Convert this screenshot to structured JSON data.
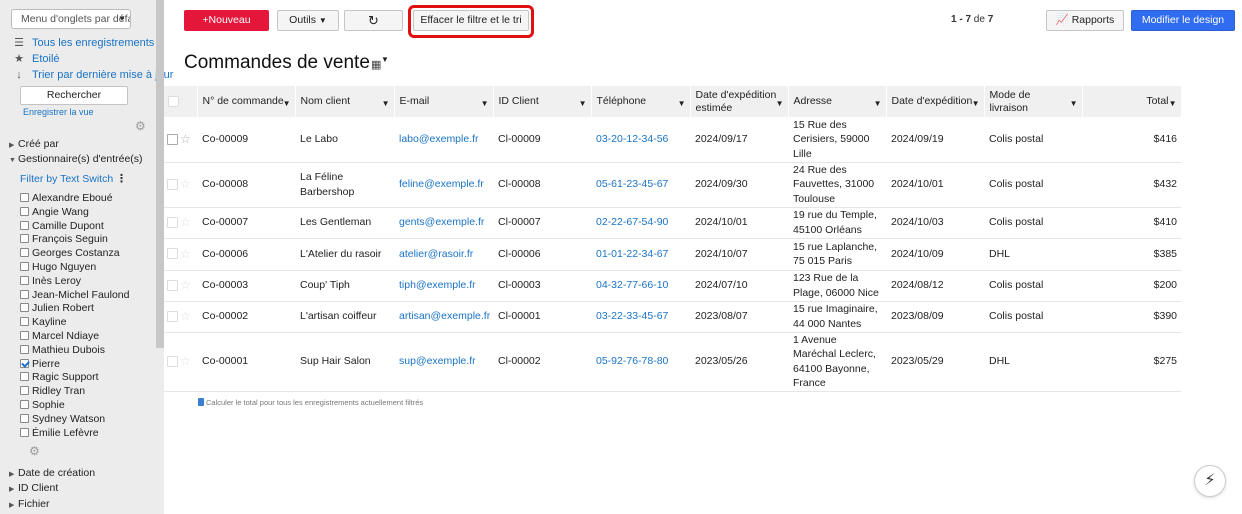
{
  "sidebar": {
    "tab_menu": "Menu d'onglets par défaut",
    "links": [
      {
        "icon": "list-icon",
        "glyph": "☰",
        "label": "Tous les enregistrements"
      },
      {
        "icon": "star-icon",
        "glyph": "★",
        "label": "Etoilé"
      },
      {
        "icon": "sort-icon",
        "glyph": "↓",
        "label": "Trier par dernière mise à jour"
      }
    ],
    "search_button": "Rechercher",
    "save_view": "Enregistrer la vue",
    "sections_top": [
      {
        "label": "Créé par",
        "expanded": false
      },
      {
        "label": "Gestionnaire(s) d'entrée(s)",
        "expanded": true
      }
    ],
    "filter_switch": "Filter by Text Switch",
    "filter_options": [
      {
        "label": "Alexandre Eboué",
        "checked": false
      },
      {
        "label": "Angie Wang",
        "checked": false
      },
      {
        "label": "Camille Dupont",
        "checked": false
      },
      {
        "label": "François Seguin",
        "checked": false
      },
      {
        "label": "Georges Costanza",
        "checked": false
      },
      {
        "label": "Hugo Nguyen",
        "checked": false
      },
      {
        "label": "Inès Leroy",
        "checked": false
      },
      {
        "label": "Jean-Michel Faulond",
        "checked": false
      },
      {
        "label": "Julien Robert",
        "checked": false
      },
      {
        "label": "Kayline",
        "checked": false
      },
      {
        "label": "Marcel Ndiaye",
        "checked": false
      },
      {
        "label": "Mathieu Dubois",
        "checked": false
      },
      {
        "label": "Pierre",
        "checked": true
      },
      {
        "label": "Ragic Support",
        "checked": false
      },
      {
        "label": "Ridley Tran",
        "checked": false
      },
      {
        "label": "Sophie",
        "checked": false
      },
      {
        "label": "Sydney Watson",
        "checked": false
      },
      {
        "label": "Émilie Lefèvre",
        "checked": false
      }
    ],
    "sections_bottom": [
      {
        "label": "Date de création",
        "expanded": false
      },
      {
        "label": "ID Client",
        "expanded": false
      },
      {
        "label": "Fichier",
        "expanded": false
      }
    ]
  },
  "toolbar": {
    "new_label": "+Nouveau",
    "tools_label": "Outils",
    "refresh_glyph": "↻",
    "clear_filter_label": "Effacer le filtre et le tri",
    "pager_range": "1 - 7",
    "pager_of": "de",
    "pager_total": "7",
    "reports_label": "Rapports",
    "design_label": "Modifier le design"
  },
  "page": {
    "title": "Commandes de vente",
    "calc_note": "Calculer le total pour tous les enregistrements actuellement filtrés"
  },
  "columns": [
    "N° de commande",
    "Nom client",
    "E-mail",
    "ID Client",
    "Téléphone",
    "Date d'expédition estimée",
    "Adresse",
    "Date d'expédition",
    "Mode de livraison",
    "Total"
  ],
  "rows": [
    {
      "order": "Co-00009",
      "client": "Le Labo",
      "email": "labo@exemple.fr",
      "client_id": "Cl-00009",
      "phone": "03-20-12-34-56",
      "est_date": "2024/09/17",
      "address": "15 Rue des Cerisiers, 59000 Lille",
      "ship_date": "2024/09/19",
      "delivery": "Colis postal",
      "total": "$416",
      "dim": false
    },
    {
      "order": "Co-00008",
      "client": "La Féline Barbershop",
      "email": "feline@exemple.fr",
      "client_id": "Cl-00008",
      "phone": "05-61-23-45-67",
      "est_date": "2024/09/30",
      "address": "24 Rue des Fauvettes, 31000 Toulouse",
      "ship_date": "2024/10/01",
      "delivery": "Colis postal",
      "total": "$432",
      "dim": true
    },
    {
      "order": "Co-00007",
      "client": "Les Gentleman",
      "email": "gents@exemple.fr",
      "client_id": "Cl-00007",
      "phone": "02-22-67-54-90",
      "est_date": "2024/10/01",
      "address": "19 rue du Temple, 45100 Orléans",
      "ship_date": "2024/10/03",
      "delivery": "Colis postal",
      "total": "$410",
      "dim": true
    },
    {
      "order": "Co-00006",
      "client": "L'Atelier du rasoir",
      "email": "atelier@rasoir.fr",
      "client_id": "Cl-00006",
      "phone": "01-01-22-34-67",
      "est_date": "2024/10/07",
      "address": "15 rue Laplanche, 75 015 Paris",
      "ship_date": "2024/10/09",
      "delivery": "DHL",
      "total": "$385",
      "dim": true
    },
    {
      "order": "Co-00003",
      "client": "Coup' Tiph",
      "email": "tiph@exemple.fr",
      "client_id": "Cl-00003",
      "phone": "04-32-77-66-10",
      "est_date": "2024/07/10",
      "address": "123 Rue de la Plage, 06000 Nice",
      "ship_date": "2024/08/12",
      "delivery": "Colis postal",
      "total": "$200",
      "dim": true
    },
    {
      "order": "Co-00002",
      "client": "L'artisan coiffeur",
      "email": "artisan@exemple.fr",
      "client_id": "Cl-00001",
      "phone": "03-22-33-45-67",
      "est_date": "2023/08/07",
      "address": "15 rue Imaginaire, 44 000 Nantes",
      "ship_date": "2023/08/09",
      "delivery": "Colis postal",
      "total": "$390",
      "dim": true
    },
    {
      "order": "Co-00001",
      "client": "Sup Hair Salon",
      "email": "sup@exemple.fr",
      "client_id": "Cl-00002",
      "phone": "05-92-76-78-80",
      "est_date": "2023/05/26",
      "address": "1 Avenue Maréchal Leclerc, 64100 Bayonne, France",
      "ship_date": "2023/05/29",
      "delivery": "DHL",
      "total": "$275",
      "dim": true
    }
  ],
  "colors": {
    "primary": "#2f6cf0",
    "new_button": "#e4163a",
    "link": "#1a73c6",
    "highlight": "#e01010"
  }
}
